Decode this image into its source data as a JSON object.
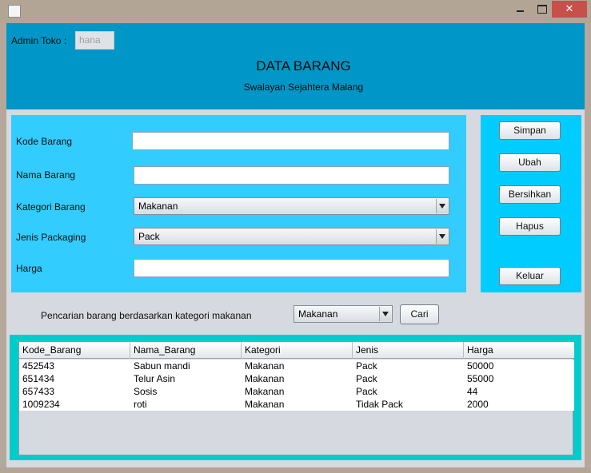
{
  "window": {
    "title": "",
    "icon": "java-icon",
    "controls": {
      "minimize": "",
      "maximize": "",
      "close": "✕"
    }
  },
  "header": {
    "admin_label": "Admin Toko  :",
    "admin_value": "hana",
    "title": "DATA BARANG",
    "subtitle": "Swalayan Sejahtera Malang",
    "bg_color": "#0096c8"
  },
  "form": {
    "kode_label": "Kode Barang",
    "kode_value": "",
    "nama_label": "Nama Barang",
    "nama_value": "",
    "kategori_label": "Kategori Barang",
    "kategori_value": "Makanan",
    "jenis_label": "Jenis Packaging",
    "jenis_value": "Pack",
    "harga_label": "Harga",
    "harga_value": "",
    "bg_color": "#33ccff"
  },
  "buttons": {
    "simpan": "Simpan",
    "ubah": "Ubah",
    "bersihkan": "Bersihkan",
    "hapus": "Hapus",
    "keluar": "Keluar",
    "bg_color": "#00ccff"
  },
  "search": {
    "label": "Pencarian barang berdasarkan kategori makanan",
    "category_value": "Makanan",
    "button": "Cari"
  },
  "table": {
    "columns": [
      "Kode_Barang",
      "Nama_Barang",
      "Kategori",
      "Jenis",
      "Harga"
    ],
    "rows": [
      [
        "452543",
        "Sabun mandi",
        "Makanan",
        "Pack",
        "50000"
      ],
      [
        "651434",
        "Telur Asin",
        "Makanan",
        "Pack",
        "55000"
      ],
      [
        "657433",
        "Sosis",
        "Makanan",
        "Pack",
        "44"
      ],
      [
        "1009234",
        "roti",
        "Makanan",
        "Tidak Pack",
        "2000"
      ]
    ],
    "panel_color": "#00cccc"
  }
}
